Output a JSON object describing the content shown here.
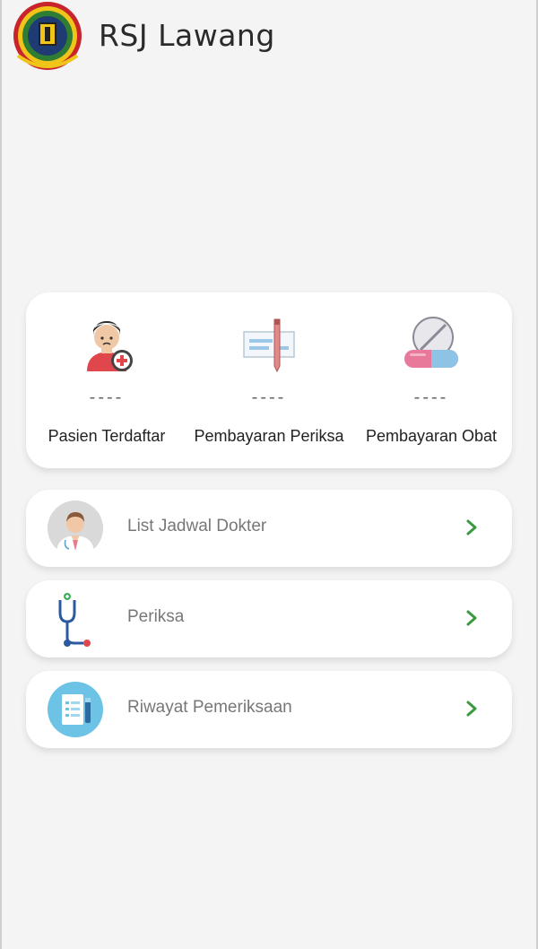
{
  "header": {
    "title": "RSJ Lawang",
    "logo_icon": "hospital-emblem-icon"
  },
  "stats": [
    {
      "value": "----",
      "label": "Pasien Terdaftar",
      "icon": "patient-add-icon"
    },
    {
      "value": "----",
      "label": "Pembayaran Periksa",
      "icon": "check-payment-icon"
    },
    {
      "value": "----",
      "label": "Pembayaran Obat",
      "icon": "pill-icon"
    }
  ],
  "menu": [
    {
      "label": "List Jadwal Dokter",
      "icon": "doctor-avatar-icon"
    },
    {
      "label": "Periksa",
      "icon": "stethoscope-icon"
    },
    {
      "label": "Riwayat Pemeriksaan",
      "icon": "medical-record-icon"
    }
  ],
  "colors": {
    "background": "#f4f4f4",
    "card": "#ffffff",
    "chevron": "#3a9a3f"
  }
}
